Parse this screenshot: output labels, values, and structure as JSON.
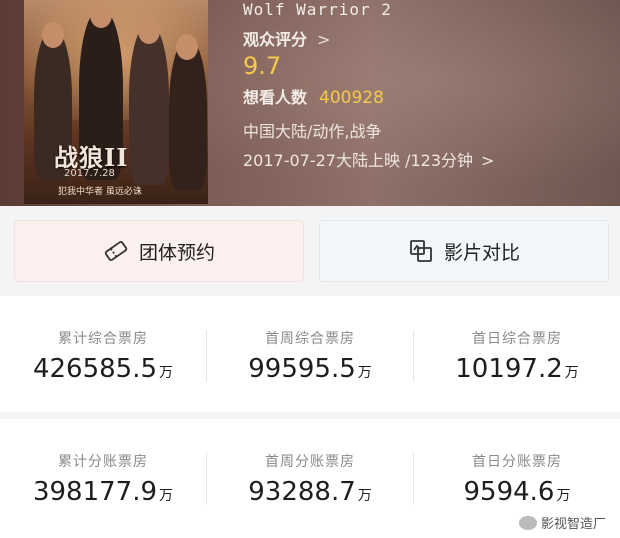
{
  "movie": {
    "title": "Wolf Warrior 2",
    "audience_rating_label": "观众评分",
    "rating": "9.7",
    "want_label": "想看人数",
    "want_count": "400928",
    "genre": "中国大陆/动作,战争",
    "release": "2017-07-27大陆上映 /123分钟",
    "chevron": ">"
  },
  "poster": {
    "title_text": "战狼II",
    "date_text": "2017.7.28",
    "tag_text": "犯我中华者 虽远必诛"
  },
  "buttons": {
    "group_label": "团体预约",
    "compare_label": "影片对比"
  },
  "stats_row1": [
    {
      "label": "累计综合票房",
      "value": "426585.5",
      "unit": "万"
    },
    {
      "label": "首周综合票房",
      "value": "99595.5",
      "unit": "万"
    },
    {
      "label": "首日综合票房",
      "value": "10197.2",
      "unit": "万"
    }
  ],
  "stats_row2": [
    {
      "label": "累计分账票房",
      "value": "398177.9",
      "unit": "万"
    },
    {
      "label": "首周分账票房",
      "value": "93288.7",
      "unit": "万"
    },
    {
      "label": "首日分账票房",
      "value": "9594.6",
      "unit": "万"
    }
  ],
  "watermark": "影视智造厂",
  "colors": {
    "accent_yellow": "#f6c94a",
    "group_button_bg": "#fbf0ee",
    "compare_button_bg": "#f3f7f9"
  },
  "icons": {
    "group_button_icon": "ticket-icon",
    "compare_button_icon": "compare-icon"
  }
}
